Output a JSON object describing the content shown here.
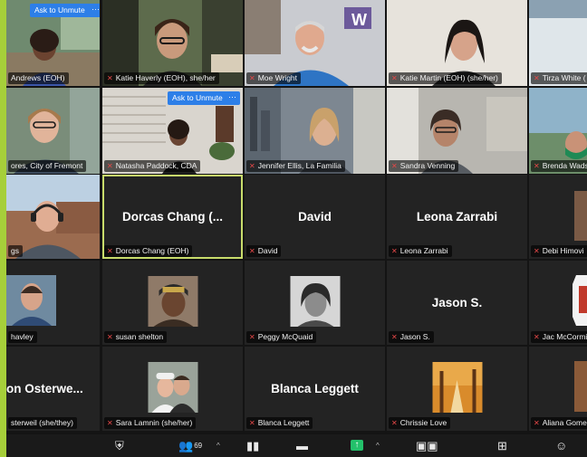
{
  "meeting": {
    "ask_to_unmute": "Ask to Unmute",
    "more_icon": "ellipsis-icon",
    "muted_icon": "muted-mic-icon",
    "tiles": [
      {
        "label": "Andrews (EOH)",
        "type": "video"
      },
      {
        "label": "Katie Haverly (EOH), she/her",
        "type": "video"
      },
      {
        "label": "Moe Wright",
        "type": "video"
      },
      {
        "label": "Katie Martin (EOH) (she/her)",
        "type": "video"
      },
      {
        "label": "Tirza White (",
        "type": "video"
      },
      {
        "label": "ores, City of Fremont",
        "type": "video"
      },
      {
        "label": "Natasha Paddock, CDA",
        "type": "video"
      },
      {
        "label": "Jennifer Ellis, La Familia",
        "type": "video"
      },
      {
        "label": "Sandra Venning",
        "type": "video"
      },
      {
        "label": "Brenda Wads",
        "type": "video"
      },
      {
        "label": "gs",
        "type": "video"
      },
      {
        "label": "Dorcas Chang (EOH)",
        "name": "Dorcas Chang (...",
        "type": "name"
      },
      {
        "label": "David",
        "name": "David",
        "type": "name"
      },
      {
        "label": "Leona Zarrabi",
        "name": "Leona Zarrabi",
        "type": "name"
      },
      {
        "label": "Debi Himovi",
        "type": "photo"
      },
      {
        "label": "havley",
        "type": "photo"
      },
      {
        "label": "susan shelton",
        "type": "photo"
      },
      {
        "label": "Peggy McQuaid",
        "type": "photo"
      },
      {
        "label": "Jason S.",
        "name": "Jason S.",
        "type": "name"
      },
      {
        "label": "Jac McCormi",
        "type": "photo"
      },
      {
        "label": "sterweil (she/they)",
        "name": "on  Osterwe...",
        "type": "name"
      },
      {
        "label": "Sara Lamnin (she/her)",
        "type": "photo"
      },
      {
        "label": "Blanca Leggett",
        "name": "Blanca Leggett",
        "type": "name"
      },
      {
        "label": "Chrissie Love",
        "type": "photo"
      },
      {
        "label": "Aliana Gome",
        "type": "photo"
      }
    ]
  },
  "toolbar": {
    "participants_count": "69",
    "security_icon": "shield-icon",
    "participants_icon": "participants-icon",
    "caret_icon": "chevron-up-icon",
    "polls_icon": "bar-chart-icon",
    "chat_icon": "chat-icon",
    "share_icon": "share-screen-icon",
    "record_icon": "record-icon",
    "breakout_icon": "breakout-rooms-icon",
    "reactions_icon": "reactions-icon"
  },
  "colors": {
    "accent": "#a6cf3a",
    "active_border": "#c8dc6b",
    "unmute_button": "#2d7fe8",
    "muted": "#e54848",
    "share": "#23c16b"
  }
}
